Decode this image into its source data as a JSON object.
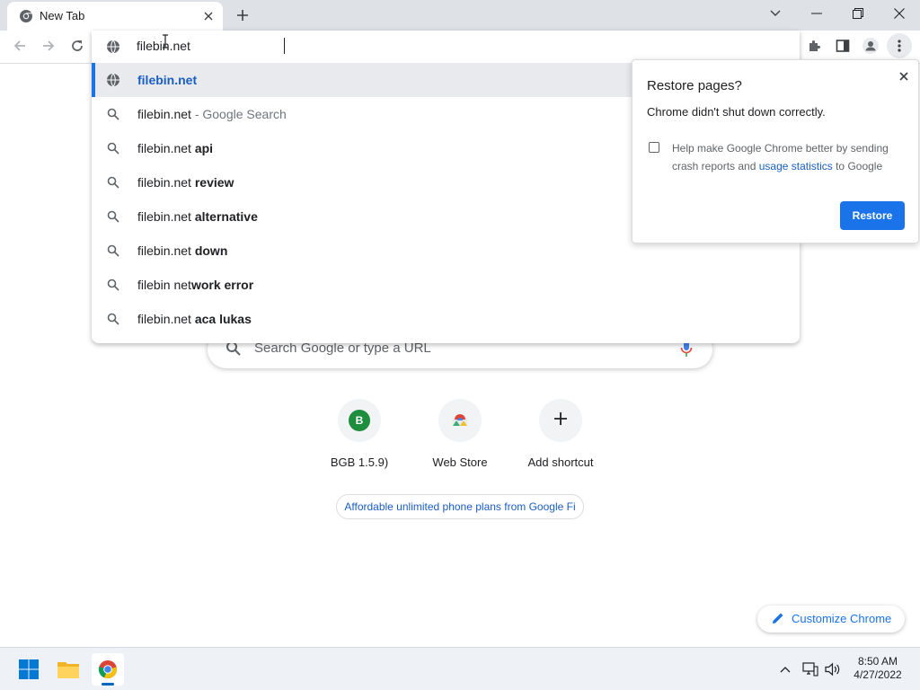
{
  "tab": {
    "title": "New Tab"
  },
  "omnibox": {
    "value": "filebin.net",
    "suggestions": [
      {
        "parts": [
          {
            "t": "filebin.net",
            "s": "blue"
          }
        ]
      },
      {
        "parts": [
          {
            "t": "filebin.net",
            "s": ""
          },
          {
            "t": " - Google Search",
            "s": "muted"
          }
        ]
      },
      {
        "parts": [
          {
            "t": "filebin.net ",
            "s": ""
          },
          {
            "t": "api",
            "s": "bold"
          }
        ]
      },
      {
        "parts": [
          {
            "t": "filebin.net ",
            "s": ""
          },
          {
            "t": "review",
            "s": "bold"
          }
        ]
      },
      {
        "parts": [
          {
            "t": "filebin.net ",
            "s": ""
          },
          {
            "t": "alternative",
            "s": "bold"
          }
        ]
      },
      {
        "parts": [
          {
            "t": "filebin.net ",
            "s": ""
          },
          {
            "t": "down",
            "s": "bold"
          }
        ]
      },
      {
        "parts": [
          {
            "t": "filebin net",
            "s": ""
          },
          {
            "t": "work error",
            "s": "bold"
          }
        ]
      },
      {
        "parts": [
          {
            "t": "filebin.net ",
            "s": ""
          },
          {
            "t": "aca lukas",
            "s": "bold"
          }
        ]
      }
    ]
  },
  "ntp": {
    "search_placeholder": "Search Google or type a URL",
    "shortcuts": [
      {
        "label": "BGB 1.5.9)",
        "badge": "B"
      },
      {
        "label": "Web Store"
      },
      {
        "label": "Add shortcut"
      }
    ],
    "promo": "Affordable unlimited phone plans from Google Fi",
    "customize_label": "Customize Chrome"
  },
  "restore_bubble": {
    "title": "Restore pages?",
    "message": "Chrome didn't shut down correctly.",
    "checkbox_text_1": "Help make Google Chrome better by sending crash reports and ",
    "checkbox_link": "usage statistics",
    "checkbox_text_2": " to Google",
    "checkbox_checked": false,
    "button_label": "Restore"
  },
  "taskbar": {
    "time": "8:50 AM",
    "date": "4/27/2022"
  },
  "colors": {
    "accent": "#1a73e8",
    "link": "#1a5ec4",
    "tabstrip": "#dee1e6",
    "selected_row": "#e8eaed",
    "shortcut_badge": "#1e8e3e"
  },
  "icons": {
    "tab_favicon": "chrome-icon",
    "omnibox_suggestion_search": "search-icon",
    "omnibox_suggestion_url": "globe-icon",
    "toolbar": [
      "extensions-icon",
      "side-panel-icon",
      "profile-icon",
      "menu-icon"
    ]
  }
}
